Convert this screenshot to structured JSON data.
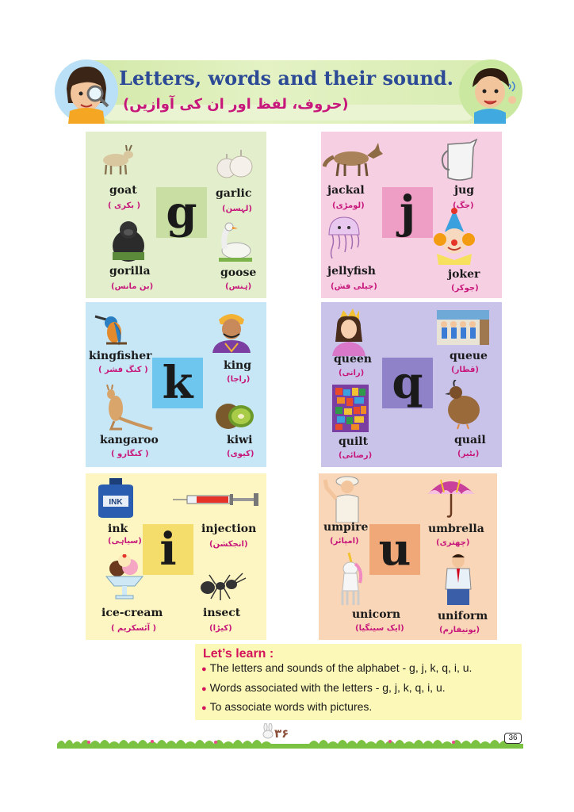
{
  "header": {
    "title": "Letters, words and their sound.",
    "title_urdu": "(حروف، لفظ اور ان کی آوازیں)"
  },
  "cards": {
    "g": {
      "letter": "g",
      "words": [
        {
          "en": "goat",
          "ur": "( بکری )"
        },
        {
          "en": "garlic",
          "ur": "(لہسن)"
        },
        {
          "en": "gorilla",
          "ur": "(بن مانس)"
        },
        {
          "en": "goose",
          "ur": "(ہنس)"
        }
      ]
    },
    "j": {
      "letter": "j",
      "words": [
        {
          "en": "jackal",
          "ur": "(لومڑی)"
        },
        {
          "en": "jug",
          "ur": "(جگ)"
        },
        {
          "en": "jellyfish",
          "ur": "(جیلی فش)"
        },
        {
          "en": "joker",
          "ur": "(جوکر)"
        }
      ]
    },
    "k": {
      "letter": "k",
      "words": [
        {
          "en": "kingfisher",
          "ur": "( کنگ فشر )"
        },
        {
          "en": "king",
          "ur": "(راجا)"
        },
        {
          "en": "kangaroo",
          "ur": "( کنگارو )"
        },
        {
          "en": "kiwi",
          "ur": "(کیوی)"
        }
      ]
    },
    "q": {
      "letter": "q",
      "words": [
        {
          "en": "queen",
          "ur": "(رانی)"
        },
        {
          "en": "queue",
          "ur": "(قطار)"
        },
        {
          "en": "quilt",
          "ur": "(رضائی)"
        },
        {
          "en": "quail",
          "ur": "(بٹیر)"
        }
      ]
    },
    "i": {
      "letter": "i",
      "words": [
        {
          "en": "ink",
          "ur": "(سیاہی)"
        },
        {
          "en": "injection",
          "ur": "(انجکشن)"
        },
        {
          "en": "ice-cream",
          "ur": "( آئسکریم )"
        },
        {
          "en": "insect",
          "ur": "(کیڑا)"
        }
      ],
      "ink_label": "INK"
    },
    "u": {
      "letter": "u",
      "words": [
        {
          "en": "umpire",
          "ur": "(امپائر)"
        },
        {
          "en": "umbrella",
          "ur": "(چھتری)"
        },
        {
          "en": "unicorn",
          "ur": "(ایک سینگیا)"
        },
        {
          "en": "uniform",
          "ur": "(یونیفارم)"
        }
      ]
    }
  },
  "learn": {
    "title": "Let’s learn :",
    "items": [
      "The letters and sounds of the alphabet - g, j, k, q, i, u.",
      "Words associated with the letters - g, j, k, q, i, u.",
      "To associate words with pictures."
    ],
    "bullet": "●"
  },
  "footer": {
    "page_urdu": "۳۶",
    "page_number": "36"
  }
}
